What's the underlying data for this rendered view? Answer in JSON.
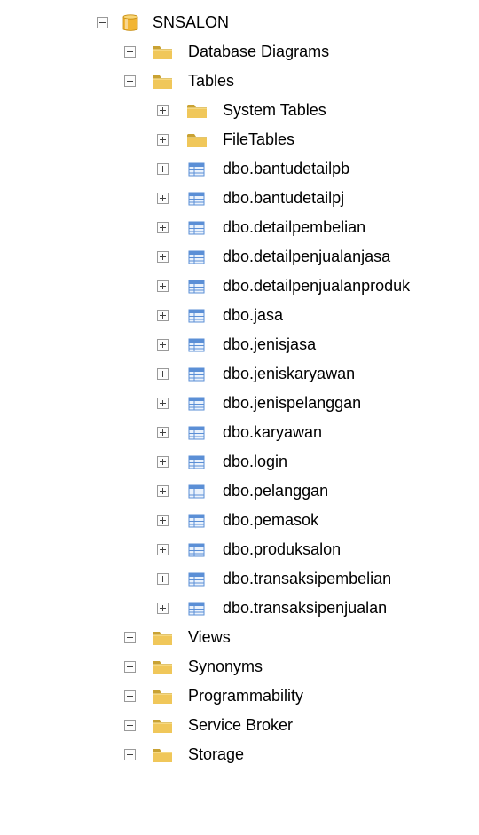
{
  "tree": {
    "root": {
      "label": "SNSALON",
      "icon": "database-icon",
      "expanded": true
    },
    "level1_top": [
      {
        "label": "Database Diagrams",
        "icon": "folder-icon",
        "expanded": false
      },
      {
        "label": "Tables",
        "icon": "folder-icon",
        "expanded": true
      }
    ],
    "table_folders": [
      {
        "label": "System Tables",
        "icon": "folder-icon",
        "expanded": false
      },
      {
        "label": "FileTables",
        "icon": "folder-icon",
        "expanded": false
      }
    ],
    "tables": [
      "dbo.bantudetailpb",
      "dbo.bantudetailpj",
      "dbo.detailpembelian",
      "dbo.detailpenjualanjasa",
      "dbo.detailpenjualanproduk",
      "dbo.jasa",
      "dbo.jenisjasa",
      "dbo.jeniskaryawan",
      "dbo.jenispelanggan",
      "dbo.karyawan",
      "dbo.login",
      "dbo.pelanggan",
      "dbo.pemasok",
      "dbo.produksalon",
      "dbo.transaksipembelian",
      "dbo.transaksipenjualan"
    ],
    "level1_bottom": [
      {
        "label": "Views",
        "icon": "folder-icon",
        "expanded": false
      },
      {
        "label": "Synonyms",
        "icon": "folder-icon",
        "expanded": false
      },
      {
        "label": "Programmability",
        "icon": "folder-icon",
        "expanded": false
      },
      {
        "label": "Service Broker",
        "icon": "folder-icon",
        "expanded": false
      },
      {
        "label": "Storage",
        "icon": "folder-icon",
        "expanded": false
      }
    ]
  },
  "colors": {
    "folder": "#f0c75a",
    "folder_dark": "#c9a233",
    "database": "#f2b533",
    "table": "#5b8fd6",
    "toggle_border": "#9a9a9a"
  }
}
